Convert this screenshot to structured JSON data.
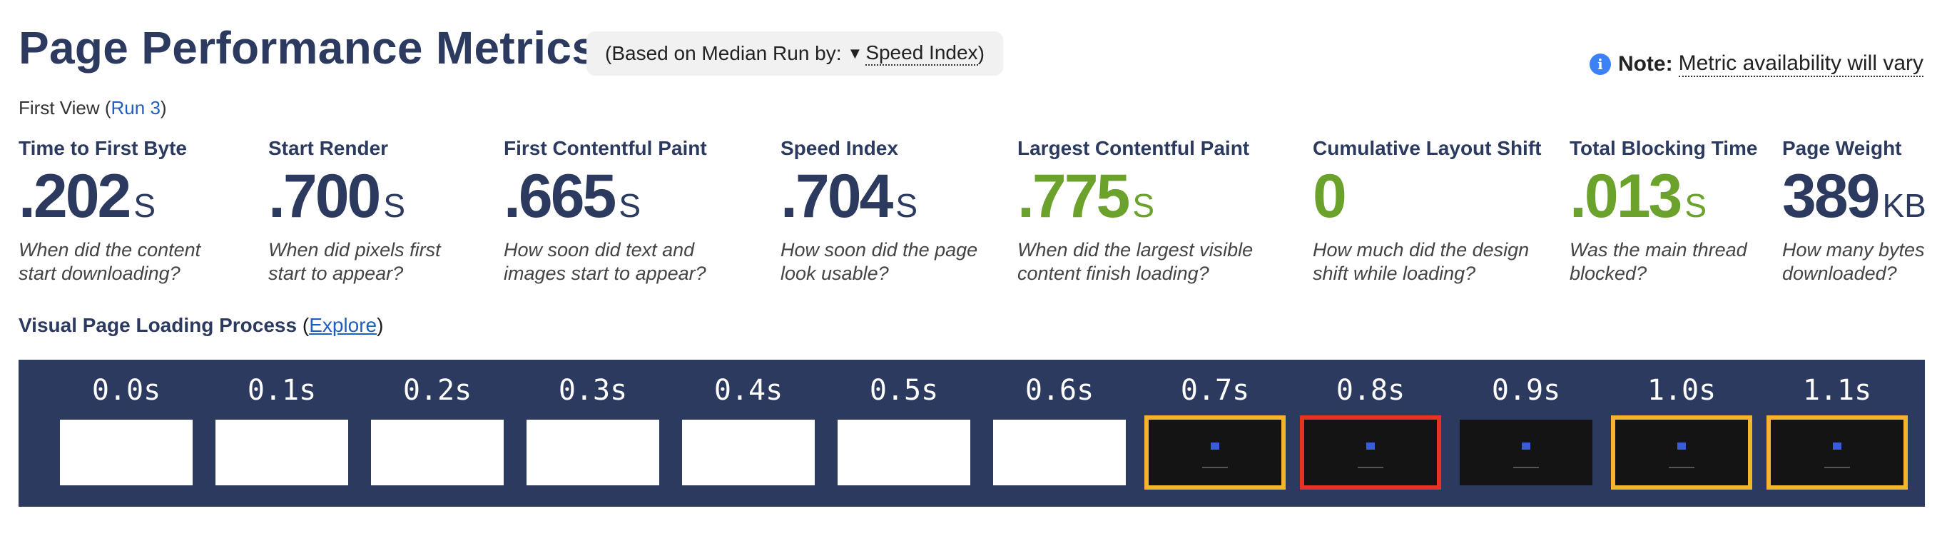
{
  "header": {
    "title": "Page Performance Metrics",
    "median_prefix": "(Based on Median Run by:",
    "median_arrow": "▼",
    "median_metric": "Speed Index",
    "median_suffix": ")",
    "note_icon": "i",
    "note_label": "Note:",
    "note_text": "Metric availability will vary"
  },
  "view": {
    "label": "First View (",
    "run_link": "Run 3",
    "suffix": ")"
  },
  "metrics": [
    {
      "label": "Time to First Byte",
      "value": ".202",
      "unit": "S",
      "desc": "When did the content start downloading?",
      "color": "#2c3a60"
    },
    {
      "label": "Start Render",
      "value": ".700",
      "unit": "S",
      "desc": "When did pixels first start to appear?",
      "color": "#2c3a60"
    },
    {
      "label": "First Contentful Paint",
      "value": ".665",
      "unit": "S",
      "desc": "How soon did text and images start to appear?",
      "color": "#2c3a60"
    },
    {
      "label": "Speed Index",
      "value": ".704",
      "unit": "S",
      "desc": "How soon did the page look usable?",
      "color": "#2c3a60"
    },
    {
      "label": "Largest Contentful Paint",
      "value": ".775",
      "unit": "S",
      "desc": "When did the largest visible content finish loading?",
      "color": "#6aa22c"
    },
    {
      "label": "Cumulative Layout Shift",
      "value": "0",
      "unit": "",
      "desc": "How much did the design shift while loading?",
      "color": "#6aa22c"
    },
    {
      "label": "Total Blocking Time",
      "value": ".013",
      "unit": "S",
      "desc": "Was the main thread blocked?",
      "color": "#6aa22c"
    },
    {
      "label": "Page Weight",
      "value": "389",
      "unit": "KB",
      "desc": "How many bytes downloaded?",
      "color": "#2c3a60"
    }
  ],
  "filmstrip": {
    "label": "Visual Page Loading Process",
    "explore_prefix": "(",
    "explore_link": "Explore",
    "explore_suffix": ")",
    "frames": [
      {
        "time": "0.0s",
        "state": "blank",
        "border": "none"
      },
      {
        "time": "0.1s",
        "state": "blank",
        "border": "none"
      },
      {
        "time": "0.2s",
        "state": "blank",
        "border": "none"
      },
      {
        "time": "0.3s",
        "state": "blank",
        "border": "none"
      },
      {
        "time": "0.4s",
        "state": "blank",
        "border": "none"
      },
      {
        "time": "0.5s",
        "state": "blank",
        "border": "none"
      },
      {
        "time": "0.6s",
        "state": "blank",
        "border": "none"
      },
      {
        "time": "0.7s",
        "state": "content",
        "border": "orange"
      },
      {
        "time": "0.8s",
        "state": "content",
        "border": "red"
      },
      {
        "time": "0.9s",
        "state": "content",
        "border": "none"
      },
      {
        "time": "1.0s",
        "state": "content",
        "border": "orange"
      },
      {
        "time": "1.1s",
        "state": "content",
        "border": "orange"
      }
    ]
  },
  "colors": {
    "navy": "#2c3a60",
    "green": "#6aa22c",
    "strip_bg": "#2d3a5f",
    "border_orange": "#f4b52c",
    "border_red": "#e53424",
    "link": "#1f5fbf"
  }
}
